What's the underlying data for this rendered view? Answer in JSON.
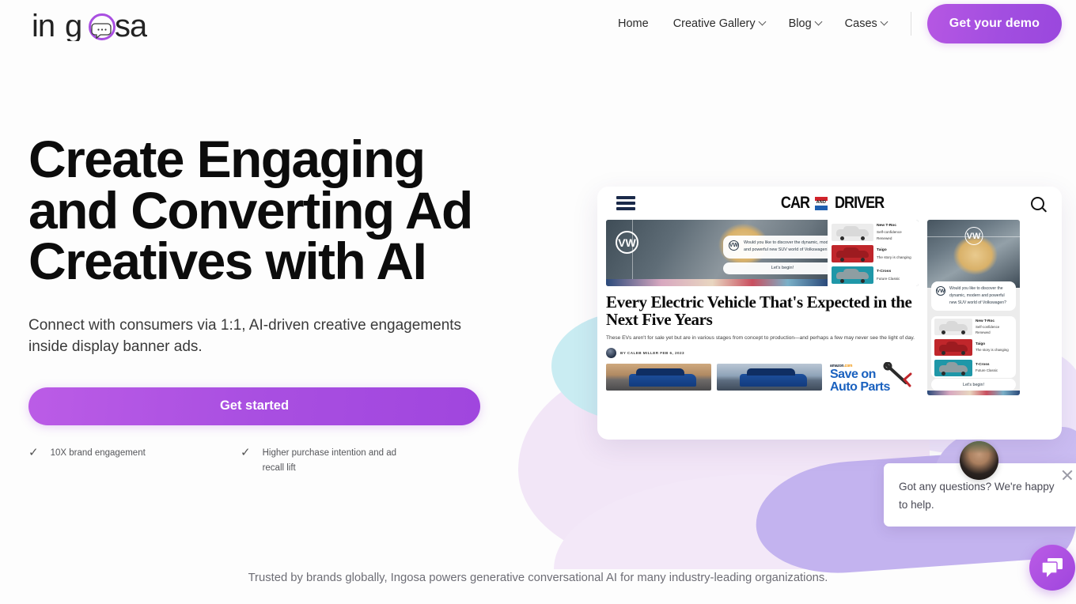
{
  "brand": {
    "name": "ingosa",
    "logo_icon": "chat-bubble-icon",
    "accent": "#a94fe1"
  },
  "header": {
    "nav": [
      {
        "label": "Home",
        "has_chevron": false
      },
      {
        "label": "Creative Gallery",
        "has_chevron": true
      },
      {
        "label": "Blog",
        "has_chevron": true
      },
      {
        "label": "Cases",
        "has_chevron": true
      }
    ],
    "cta": "Get your demo"
  },
  "hero": {
    "headline": "Create Engaging and Converting Ad Creatives with AI",
    "subtitle": "Connect with consumers via 1:1, AI-driven creative engagements inside display banner ads.",
    "cta": "Get started",
    "features": [
      {
        "icon": "check-icon",
        "text": "10X brand engagement"
      },
      {
        "icon": "check-icon",
        "text": "Higher purchase intention and ad recall lift"
      }
    ]
  },
  "mockup": {
    "site_logo": {
      "part1": "CAR",
      "badge": "AND",
      "part2": "DRIVER"
    },
    "menu_icon": "hamburger-icon",
    "search_icon": "search-icon",
    "article": {
      "headline": "Every Electric Vehicle That's Expected in the Next Five Years",
      "deck": "These EVs aren't for sale yet but are in various stages from concept to production—and perhaps a few may never see the light of day.",
      "byline": "BY CALEB MILLER  FEB 6, 2023"
    },
    "ad": {
      "brand_icon": "vw-logo-icon",
      "message": "Would you like to discover the dynamic, modern and powerful new SUV world of Volkswagen?",
      "cta": "Let's begin!",
      "cars": [
        {
          "name": "New T-Roc",
          "tagline": "Self-confidence Renewed",
          "color": "#d9d9d9"
        },
        {
          "name": "Taigo",
          "tagline": "The story is changing",
          "color": "#c0262b"
        },
        {
          "name": "T-Cross",
          "tagline": "Future Classic",
          "color": "#1f97a8"
        }
      ]
    },
    "sponsor": {
      "brand": "amazon",
      "brand_suffix": ".com",
      "line1": "Save on",
      "line2": "Auto Parts"
    }
  },
  "chat": {
    "message": "Got any questions? We're happy to help.",
    "close_icon": "close-icon",
    "launcher_icon": "chat-icon",
    "avatar": "agent-avatar"
  },
  "footer": {
    "trusted": "Trusted by brands globally, Ingosa powers generative conversational AI for many industry-leading organizations."
  }
}
